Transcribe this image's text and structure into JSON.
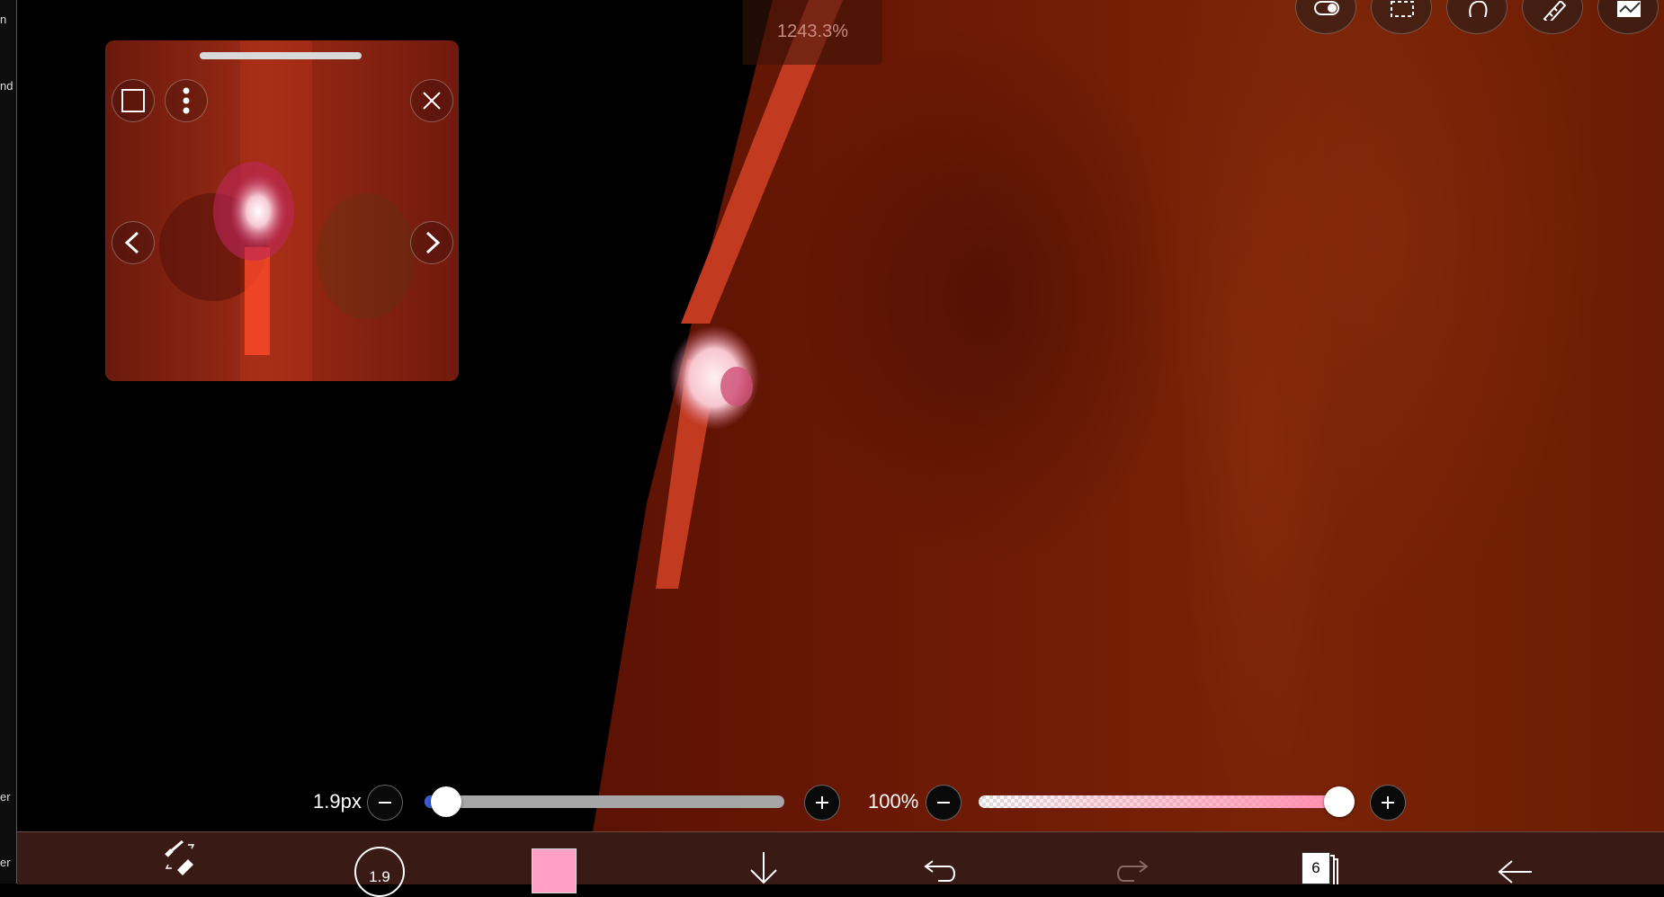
{
  "left_panel": {
    "labels": [
      "n",
      "nd",
      "er",
      "er"
    ]
  },
  "canvas": {
    "zoom_label": "1243.3%"
  },
  "top_tools": [
    {
      "name": "toggle-icon"
    },
    {
      "name": "selection-icon"
    },
    {
      "name": "hand-icon"
    },
    {
      "name": "ruler-icon"
    },
    {
      "name": "canvas-icon"
    }
  ],
  "reference_window": {
    "icons": [
      "frame-icon",
      "more-icon",
      "close-icon",
      "prev-icon",
      "next-icon"
    ]
  },
  "brush_size": {
    "label": "1.9px",
    "value_fraction": 0.06
  },
  "opacity": {
    "label": "100%",
    "value_fraction": 1.0
  },
  "toolbar": {
    "brush_size_value": "1.9",
    "color": "#ff9fc6",
    "layer_count": "6"
  },
  "colors": {
    "canvas_dark_red": "#6e1a04",
    "stroke_red": "#c23a1f",
    "toolbar_bg": "#3a1a14",
    "accent_pink": "#ff9fc6"
  }
}
